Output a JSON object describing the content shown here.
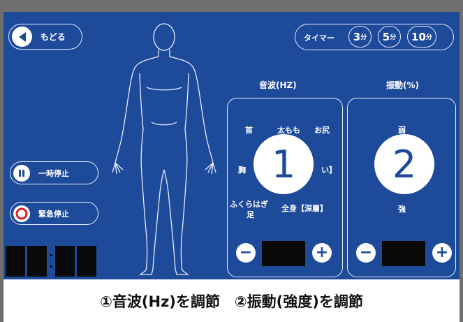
{
  "back_button": {
    "label": "もどる"
  },
  "timer": {
    "label": "タイマー",
    "options": [
      {
        "value": "3",
        "unit": "分"
      },
      {
        "value": "5",
        "unit": "分"
      },
      {
        "value": "10",
        "unit": "分"
      }
    ]
  },
  "sound_wave": {
    "title": "音波(HZ)",
    "options": [
      "首",
      "太もも",
      "お尻",
      "胸",
      "い】",
      "ふくらはぎ",
      "足",
      "全身【深層】"
    ],
    "marker": "1"
  },
  "vibration": {
    "title": "振動(%)",
    "weak": "弱",
    "strong": "強",
    "marker": "2"
  },
  "stepper": {
    "minus": "−",
    "plus": "+"
  },
  "controls": {
    "pause": "一時停止",
    "emergency": "緊急停止"
  },
  "caption": "①音波(Hz)を調節　②振動(強度)を調節",
  "colors": {
    "panel": "#1e4a9a",
    "emergency_ring": "#d8202a"
  }
}
